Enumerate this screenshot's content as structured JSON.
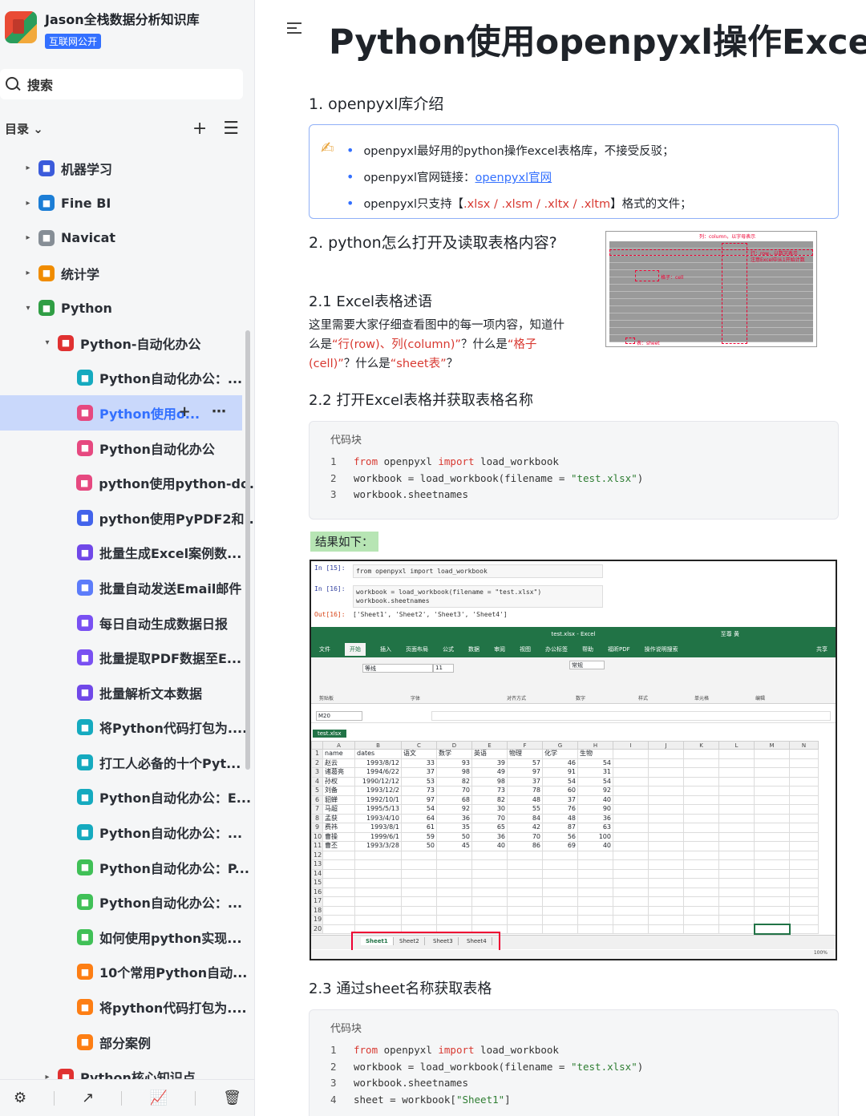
{
  "sidebar": {
    "kb_title": "Jason全栈数据分析知识库",
    "kb_badge": "互联网公开",
    "search_label": "搜索",
    "toc_label": "目录 ⌄",
    "items": [
      {
        "label": "机器学习",
        "level": 0,
        "caret": "▸",
        "icon_color": "#3b5bdb",
        "icon": "chart-icon"
      },
      {
        "label": "Fine BI",
        "level": 0,
        "caret": "▸",
        "icon_color": "#1c7ed6",
        "icon": "globe-icon"
      },
      {
        "label": "Navicat",
        "level": 0,
        "caret": "▸",
        "icon_color": "#868e96",
        "icon": "gear-icon"
      },
      {
        "label": "统计学",
        "level": 0,
        "caret": "▸",
        "icon_color": "#f08c00",
        "icon": "doc-icon"
      },
      {
        "label": "Python",
        "level": 0,
        "caret": "▾",
        "icon_color": "#2f9e44",
        "icon": "folder-icon"
      },
      {
        "label": "Python-自动化办公",
        "level": 1,
        "caret": "▾",
        "icon_color": "#e03131",
        "icon": "target-icon"
      },
      {
        "label": "Python自动化办公：...",
        "level": 2,
        "caret": "",
        "icon_color": "#15aabf",
        "icon": "doc-icon"
      },
      {
        "label": "Python使用o...",
        "level": 2,
        "caret": "",
        "icon_color": "#e64980",
        "icon": "doc-icon",
        "active": true
      },
      {
        "label": "Python自动化办公",
        "level": 2,
        "caret": "",
        "icon_color": "#e64980",
        "icon": "doc-icon"
      },
      {
        "label": "python使用python-do...",
        "level": 2,
        "caret": "",
        "icon_color": "#e64980",
        "icon": "doc-icon"
      },
      {
        "label": "python使用PyPDF2和...",
        "level": 2,
        "caret": "",
        "icon_color": "#4263eb",
        "icon": "doc-icon"
      },
      {
        "label": "批量生成Excel案例数...",
        "level": 2,
        "caret": "",
        "icon_color": "#7048e8",
        "icon": "doc-icon"
      },
      {
        "label": "批量自动发送Email邮件",
        "level": 2,
        "caret": "",
        "icon_color": "#5c7cfa",
        "icon": "doc-icon"
      },
      {
        "label": "每日自动生成数据日报",
        "level": 2,
        "caret": "",
        "icon_color": "#7950f2",
        "icon": "doc-icon"
      },
      {
        "label": "批量提取PDF数据至E...",
        "level": 2,
        "caret": "",
        "icon_color": "#7950f2",
        "icon": "doc-icon"
      },
      {
        "label": "批量解析文本数据",
        "level": 2,
        "caret": "",
        "icon_color": "#7048e8",
        "icon": "doc-icon"
      },
      {
        "label": "将Python代码打包为....",
        "level": 2,
        "caret": "",
        "icon_color": "#15aabf",
        "icon": "doc-icon"
      },
      {
        "label": "打工人必备的十个Pyt...",
        "level": 2,
        "caret": "",
        "icon_color": "#15aabf",
        "icon": "doc-icon"
      },
      {
        "label": "Python自动化办公：E...",
        "level": 2,
        "caret": "",
        "icon_color": "#15aabf",
        "icon": "doc-icon"
      },
      {
        "label": "Python自动化办公：...",
        "level": 2,
        "caret": "",
        "icon_color": "#15aabf",
        "icon": "doc-icon"
      },
      {
        "label": "Python自动化办公：P...",
        "level": 2,
        "caret": "",
        "icon_color": "#40c057",
        "icon": "doc-icon"
      },
      {
        "label": "Python自动化办公：...",
        "level": 2,
        "caret": "",
        "icon_color": "#40c057",
        "icon": "doc-icon"
      },
      {
        "label": "如何使用python实现...",
        "level": 2,
        "caret": "",
        "icon_color": "#40c057",
        "icon": "doc-icon"
      },
      {
        "label": "10个常用Python自动...",
        "level": 2,
        "caret": "",
        "icon_color": "#fd7e14",
        "icon": "doc-icon"
      },
      {
        "label": "将python代码打包为....",
        "level": 2,
        "caret": "",
        "icon_color": "#fd7e14",
        "icon": "doc-icon"
      },
      {
        "label": "部分案例",
        "level": 2,
        "caret": "",
        "icon_color": "#fd7e14",
        "icon": "doc-icon"
      },
      {
        "label": "Python核心知识点",
        "level": 1,
        "caret": "▸",
        "icon_color": "#e03131",
        "icon": "target-icon"
      }
    ]
  },
  "doc": {
    "title": "Python使用openpyxl操作Excel",
    "h1": "1. openpyxl库介绍",
    "callout": {
      "line1": "openpyxl最好用的python操作excel表格库，不接受反驳；",
      "line2_prefix": "openpyxl官网链接：",
      "line2_link": "openpyxl官网",
      "line3_prefix": "openpyxl只支持【",
      "line3_red": ".xlsx / .xlsm / .xltx / .xltm",
      "line3_suffix": "】格式的文件；"
    },
    "h2": "2. python怎么打开及读取表格内容?",
    "h21": "2.1 Excel表格述语",
    "para": {
      "a": "这里需要大家仔细查看图中的每一项内容，知道什么是",
      "b": "“行(row)、列(column)”",
      "c": "？什么是",
      "d": "“格子(cell)”",
      "e": "？什么是",
      "f": "“sheet表”",
      "g": "？"
    },
    "thumb": {
      "col_note": "列：column，以字母表示",
      "row_note": "行：row，以数字表示",
      "row_note2": "注意Excel中从1开始计数",
      "cell_note": "格子：cell",
      "sheet_note": "表：sheet"
    },
    "h22": "2.2 打开Excel表格并获取表格名称",
    "code_title": "代码块",
    "result_label": "结果如下：",
    "h23": "2.3 通过sheet名称获取表格"
  },
  "code1": [
    {
      "n": "1",
      "parts": [
        [
          "kw",
          "from"
        ],
        [
          "t",
          " openpyxl "
        ],
        [
          "kw",
          "import"
        ],
        [
          "t",
          " load_workbook"
        ]
      ]
    },
    {
      "n": "2",
      "parts": [
        [
          "t",
          "workbook = load_workbook(filename = "
        ],
        [
          "str",
          "\"test.xlsx\""
        ],
        [
          "t",
          ")"
        ]
      ]
    },
    {
      "n": "3",
      "parts": [
        [
          "t",
          "workbook.sheetnames"
        ]
      ]
    }
  ],
  "code2": [
    {
      "n": "1",
      "parts": [
        [
          "kw",
          "from"
        ],
        [
          "t",
          " openpyxl "
        ],
        [
          "kw",
          "import"
        ],
        [
          "t",
          " load_workbook"
        ]
      ]
    },
    {
      "n": "2",
      "parts": [
        [
          "t",
          "workbook = load_workbook(filename = "
        ],
        [
          "str",
          "\"test.xlsx\""
        ],
        [
          "t",
          ")"
        ]
      ]
    },
    {
      "n": "3",
      "parts": [
        [
          "t",
          "workbook.sheetnames"
        ]
      ]
    },
    {
      "n": "4",
      "parts": [
        [
          "t",
          "sheet = workbook["
        ],
        [
          "str",
          "\"Sheet1\""
        ],
        [
          "t",
          "]"
        ]
      ]
    }
  ],
  "jupyter": {
    "in1_prompt": "In  [15]:",
    "in1_code": "from openpyxl import load_workbook",
    "in2_prompt": "In  [16]:",
    "in2_code1": "workbook = load_workbook(filename = \"test.xlsx\")",
    "in2_code2": "workbook.sheetnames",
    "out_prompt": "Out[16]:",
    "out_text": "['Sheet1', 'Sheet2', 'Sheet3', 'Sheet4']"
  },
  "excel": {
    "window_title": "test.xlsx - Excel",
    "user": "至尊 黄",
    "tabs": [
      "文件",
      "开始",
      "插入",
      "页面布局",
      "公式",
      "数据",
      "审阅",
      "视图",
      "办公标签",
      "帮助",
      "福昕PDF",
      "操作说明搜索"
    ],
    "share": "共享",
    "groups": [
      "剪贴板",
      "字体",
      "对齐方式",
      "数字",
      "样式",
      "单元格",
      "编辑"
    ],
    "font_name": "等线",
    "font_size": "11",
    "number_format": "常规",
    "name_box": "M20",
    "workbook_tab": "test.xlsx",
    "columns": [
      "A",
      "B",
      "C",
      "D",
      "E",
      "F",
      "G",
      "H",
      "I",
      "J",
      "K",
      "L",
      "M",
      "N"
    ],
    "rows": [
      [
        "name",
        "dates",
        "语文",
        "数学",
        "英语",
        "物理",
        "化学",
        "生物"
      ],
      [
        "赵云",
        "1993/8/12",
        "33",
        "93",
        "39",
        "57",
        "46",
        "54"
      ],
      [
        "诸葛亮",
        "1994/6/22",
        "37",
        "98",
        "49",
        "97",
        "91",
        "31"
      ],
      [
        "孙权",
        "1990/12/12",
        "53",
        "82",
        "98",
        "37",
        "54",
        "54"
      ],
      [
        "刘备",
        "1993/12/2",
        "73",
        "70",
        "73",
        "78",
        "60",
        "92"
      ],
      [
        "貂蝉",
        "1992/10/1",
        "97",
        "68",
        "82",
        "48",
        "37",
        "40"
      ],
      [
        "马超",
        "1995/5/13",
        "54",
        "92",
        "30",
        "55",
        "76",
        "90"
      ],
      [
        "孟获",
        "1993/4/10",
        "64",
        "36",
        "70",
        "84",
        "48",
        "36"
      ],
      [
        "费祎",
        "1993/8/1",
        "61",
        "35",
        "65",
        "42",
        "87",
        "63"
      ],
      [
        "曹操",
        "1999/6/1",
        "59",
        "50",
        "36",
        "70",
        "56",
        "100"
      ],
      [
        "曹丕",
        "1993/3/28",
        "50",
        "45",
        "40",
        "86",
        "69",
        "40"
      ]
    ],
    "empty_rows": [
      "12",
      "13",
      "14",
      "15",
      "16",
      "17",
      "18",
      "19",
      "20"
    ],
    "sheets": [
      "Sheet1",
      "Sheet2",
      "Sheet3",
      "Sheet4"
    ],
    "zoom": "100%"
  },
  "colors": {
    "accent": "#3370ff",
    "active_bg": "#c9d8fb",
    "excel_green": "#217346",
    "red": "#d83931"
  }
}
